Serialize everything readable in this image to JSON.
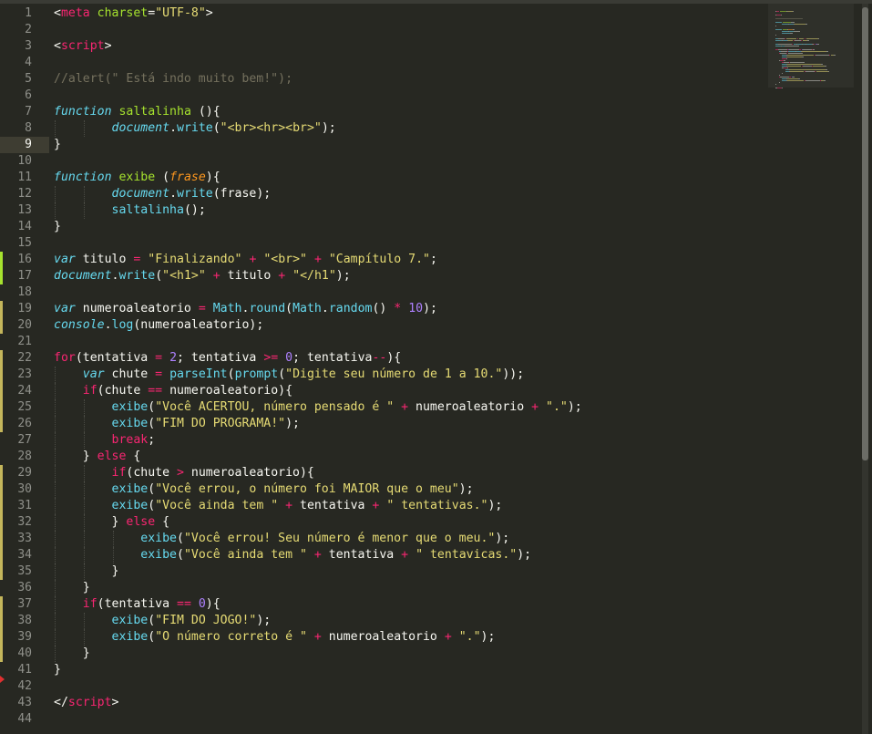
{
  "editor": {
    "theme_colors": {
      "background": "#272822",
      "text": "#F8F8F2",
      "tag": "#F92672",
      "attribute": "#A6E22E",
      "string": "#E6DB74",
      "comment": "#75715E",
      "storage": "#66D9EF",
      "entity": "#A6E22E",
      "parameter": "#FD971F",
      "keyword": "#F92672",
      "number": "#AE81FF",
      "gutter_added": "#A6E22E",
      "gutter_modified": "#C4B65B",
      "fold_marker": "#E03030"
    },
    "current_line": 9,
    "fold_marker_line": 41,
    "gutter_added_lines": [
      16,
      17
    ],
    "gutter_modified_lines": [
      19,
      20,
      22,
      23,
      24,
      25,
      26,
      29,
      30,
      31,
      32,
      33,
      34,
      35,
      37,
      38,
      39,
      40
    ],
    "lines": [
      {
        "n": "1",
        "indent": 0,
        "tokens": [
          [
            "tag-punct",
            "<"
          ],
          [
            "tag",
            "meta"
          ],
          [
            "text",
            " "
          ],
          [
            "attr",
            "charset"
          ],
          [
            "text",
            "="
          ],
          [
            "str",
            "\"UTF-8\""
          ],
          [
            "text",
            ">"
          ]
        ]
      },
      {
        "n": "2",
        "indent": 0,
        "tokens": []
      },
      {
        "n": "3",
        "indent": 0,
        "tokens": [
          [
            "text",
            "<"
          ],
          [
            "tag",
            "script"
          ],
          [
            "text",
            ">"
          ]
        ]
      },
      {
        "n": "4",
        "indent": 0,
        "tokens": []
      },
      {
        "n": "5",
        "indent": 0,
        "tokens": [
          [
            "comment",
            "//alert(\" Está indo muito bem!\");"
          ]
        ]
      },
      {
        "n": "6",
        "indent": 0,
        "tokens": []
      },
      {
        "n": "7",
        "indent": 0,
        "tokens": [
          [
            "storage",
            "function"
          ],
          [
            "text",
            " "
          ],
          [
            "entity",
            "saltalinha"
          ],
          [
            "text",
            " (){"
          ]
        ]
      },
      {
        "n": "8",
        "indent": 2,
        "tokens": [
          [
            "support-i",
            "document"
          ],
          [
            "text",
            "."
          ],
          [
            "support",
            "write"
          ],
          [
            "text",
            "("
          ],
          [
            "str",
            "\"<br><hr><br>\""
          ],
          [
            "text",
            ");"
          ]
        ]
      },
      {
        "n": "9",
        "indent": 0,
        "tokens": [
          [
            "text",
            "}"
          ]
        ]
      },
      {
        "n": "10",
        "indent": 0,
        "tokens": []
      },
      {
        "n": "11",
        "indent": 0,
        "tokens": [
          [
            "storage",
            "function"
          ],
          [
            "text",
            " "
          ],
          [
            "entity",
            "exibe"
          ],
          [
            "text",
            " ("
          ],
          [
            "param",
            "frase"
          ],
          [
            "text",
            "){"
          ]
        ]
      },
      {
        "n": "12",
        "indent": 2,
        "tokens": [
          [
            "support-i",
            "document"
          ],
          [
            "text",
            "."
          ],
          [
            "support",
            "write"
          ],
          [
            "text",
            "(frase);"
          ]
        ]
      },
      {
        "n": "13",
        "indent": 2,
        "tokens": [
          [
            "support",
            "saltalinha"
          ],
          [
            "text",
            "();"
          ]
        ]
      },
      {
        "n": "14",
        "indent": 0,
        "tokens": [
          [
            "text",
            "}"
          ]
        ]
      },
      {
        "n": "15",
        "indent": 0,
        "tokens": []
      },
      {
        "n": "16",
        "indent": 0,
        "tokens": [
          [
            "storage",
            "var"
          ],
          [
            "text",
            " titulo "
          ],
          [
            "op",
            "="
          ],
          [
            "text",
            " "
          ],
          [
            "str",
            "\"Finalizando\""
          ],
          [
            "text",
            " "
          ],
          [
            "op",
            "+"
          ],
          [
            "text",
            " "
          ],
          [
            "str",
            "\"<br>\""
          ],
          [
            "text",
            " "
          ],
          [
            "op",
            "+"
          ],
          [
            "text",
            " "
          ],
          [
            "str",
            "\"Campítulo 7.\""
          ],
          [
            "text",
            ";"
          ]
        ]
      },
      {
        "n": "17",
        "indent": 0,
        "tokens": [
          [
            "support-i",
            "document"
          ],
          [
            "text",
            "."
          ],
          [
            "support",
            "write"
          ],
          [
            "text",
            "("
          ],
          [
            "str",
            "\"<h1>\""
          ],
          [
            "text",
            " "
          ],
          [
            "op",
            "+"
          ],
          [
            "text",
            " titulo "
          ],
          [
            "op",
            "+"
          ],
          [
            "text",
            " "
          ],
          [
            "str",
            "\"</h1\""
          ],
          [
            "text",
            ");"
          ]
        ]
      },
      {
        "n": "18",
        "indent": 0,
        "tokens": []
      },
      {
        "n": "19",
        "indent": 0,
        "tokens": [
          [
            "storage",
            "var"
          ],
          [
            "text",
            " numeroaleatorio "
          ],
          [
            "op",
            "="
          ],
          [
            "text",
            " "
          ],
          [
            "support",
            "Math"
          ],
          [
            "text",
            "."
          ],
          [
            "support",
            "round"
          ],
          [
            "text",
            "("
          ],
          [
            "support",
            "Math"
          ],
          [
            "text",
            "."
          ],
          [
            "support",
            "random"
          ],
          [
            "text",
            "() "
          ],
          [
            "op",
            "*"
          ],
          [
            "text",
            " "
          ],
          [
            "num",
            "10"
          ],
          [
            "text",
            ");"
          ]
        ]
      },
      {
        "n": "20",
        "indent": 0,
        "tokens": [
          [
            "support-i",
            "console"
          ],
          [
            "text",
            "."
          ],
          [
            "support",
            "log"
          ],
          [
            "text",
            "(numeroaleatorio);"
          ]
        ]
      },
      {
        "n": "21",
        "indent": 0,
        "tokens": []
      },
      {
        "n": "22",
        "indent": 0,
        "tokens": [
          [
            "kw",
            "for"
          ],
          [
            "text",
            "(tentativa "
          ],
          [
            "op",
            "="
          ],
          [
            "text",
            " "
          ],
          [
            "num",
            "2"
          ],
          [
            "text",
            "; tentativa "
          ],
          [
            "op",
            ">="
          ],
          [
            "text",
            " "
          ],
          [
            "num",
            "0"
          ],
          [
            "text",
            "; tentativa"
          ],
          [
            "op",
            "--"
          ],
          [
            "text",
            "){"
          ]
        ]
      },
      {
        "n": "23",
        "indent": 1,
        "tokens": [
          [
            "storage",
            "var"
          ],
          [
            "text",
            " chute "
          ],
          [
            "op",
            "="
          ],
          [
            "text",
            " "
          ],
          [
            "support",
            "parseInt"
          ],
          [
            "text",
            "("
          ],
          [
            "support",
            "prompt"
          ],
          [
            "text",
            "("
          ],
          [
            "str",
            "\"Digite seu número de 1 a 10.\""
          ],
          [
            "text",
            "));"
          ]
        ]
      },
      {
        "n": "24",
        "indent": 1,
        "tokens": [
          [
            "kw",
            "if"
          ],
          [
            "text",
            "(chute "
          ],
          [
            "op",
            "=="
          ],
          [
            "text",
            " numeroaleatorio){"
          ]
        ]
      },
      {
        "n": "25",
        "indent": 2,
        "tokens": [
          [
            "support",
            "exibe"
          ],
          [
            "text",
            "("
          ],
          [
            "str",
            "\"Você ACERTOU, número pensado é \""
          ],
          [
            "text",
            " "
          ],
          [
            "op",
            "+"
          ],
          [
            "text",
            " numeroaleatorio "
          ],
          [
            "op",
            "+"
          ],
          [
            "text",
            " "
          ],
          [
            "str",
            "\".\""
          ],
          [
            "text",
            ");"
          ]
        ]
      },
      {
        "n": "26",
        "indent": 2,
        "tokens": [
          [
            "support",
            "exibe"
          ],
          [
            "text",
            "("
          ],
          [
            "str",
            "\"FIM DO PROGRAMA!\""
          ],
          [
            "text",
            ");"
          ]
        ]
      },
      {
        "n": "27",
        "indent": 2,
        "tokens": [
          [
            "kw",
            "break"
          ],
          [
            "text",
            ";"
          ]
        ]
      },
      {
        "n": "28",
        "indent": 1,
        "tokens": [
          [
            "text",
            "} "
          ],
          [
            "kw",
            "else"
          ],
          [
            "text",
            " {"
          ]
        ]
      },
      {
        "n": "29",
        "indent": 2,
        "tokens": [
          [
            "kw",
            "if"
          ],
          [
            "text",
            "(chute "
          ],
          [
            "op",
            ">"
          ],
          [
            "text",
            " numeroaleatorio){"
          ]
        ]
      },
      {
        "n": "30",
        "indent": 2,
        "tokens": [
          [
            "support",
            "exibe"
          ],
          [
            "text",
            "("
          ],
          [
            "str",
            "\"Você errou, o número foi MAIOR que o meu\""
          ],
          [
            "text",
            ");"
          ]
        ]
      },
      {
        "n": "31",
        "indent": 2,
        "tokens": [
          [
            "support",
            "exibe"
          ],
          [
            "text",
            "("
          ],
          [
            "str",
            "\"Você ainda tem \""
          ],
          [
            "text",
            " "
          ],
          [
            "op",
            "+"
          ],
          [
            "text",
            " tentativa "
          ],
          [
            "op",
            "+"
          ],
          [
            "text",
            " "
          ],
          [
            "str",
            "\" tentativas.\""
          ],
          [
            "text",
            ");"
          ]
        ]
      },
      {
        "n": "32",
        "indent": 2,
        "tokens": [
          [
            "text",
            "} "
          ],
          [
            "kw",
            "else"
          ],
          [
            "text",
            " {"
          ]
        ]
      },
      {
        "n": "33",
        "indent": 3,
        "tokens": [
          [
            "support",
            "exibe"
          ],
          [
            "text",
            "("
          ],
          [
            "str",
            "\"Você errou! Seu número é menor que o meu.\""
          ],
          [
            "text",
            ");"
          ]
        ]
      },
      {
        "n": "34",
        "indent": 3,
        "tokens": [
          [
            "support",
            "exibe"
          ],
          [
            "text",
            "("
          ],
          [
            "str",
            "\"Você ainda tem \""
          ],
          [
            "text",
            " "
          ],
          [
            "op",
            "+"
          ],
          [
            "text",
            " tentativa "
          ],
          [
            "op",
            "+"
          ],
          [
            "text",
            " "
          ],
          [
            "str",
            "\" tentavicas.\""
          ],
          [
            "text",
            ");"
          ]
        ]
      },
      {
        "n": "35",
        "indent": 2,
        "tokens": [
          [
            "text",
            "}"
          ]
        ]
      },
      {
        "n": "36",
        "indent": 1,
        "tokens": [
          [
            "text",
            "}"
          ]
        ]
      },
      {
        "n": "37",
        "indent": 1,
        "tokens": [
          [
            "kw",
            "if"
          ],
          [
            "text",
            "(tentativa "
          ],
          [
            "op",
            "=="
          ],
          [
            "text",
            " "
          ],
          [
            "num",
            "0"
          ],
          [
            "text",
            "){"
          ]
        ]
      },
      {
        "n": "38",
        "indent": 2,
        "tokens": [
          [
            "support",
            "exibe"
          ],
          [
            "text",
            "("
          ],
          [
            "str",
            "\"FIM DO JOGO!\""
          ],
          [
            "text",
            ");"
          ]
        ]
      },
      {
        "n": "39",
        "indent": 2,
        "tokens": [
          [
            "support",
            "exibe"
          ],
          [
            "text",
            "("
          ],
          [
            "str",
            "\"O número correto é \""
          ],
          [
            "text",
            " "
          ],
          [
            "op",
            "+"
          ],
          [
            "text",
            " numeroaleatorio "
          ],
          [
            "op",
            "+"
          ],
          [
            "text",
            " "
          ],
          [
            "str",
            "\".\""
          ],
          [
            "text",
            ");"
          ]
        ]
      },
      {
        "n": "40",
        "indent": 1,
        "tokens": [
          [
            "text",
            "}"
          ]
        ]
      },
      {
        "n": "41",
        "indent": 0,
        "tokens": [
          [
            "text",
            "}"
          ]
        ]
      },
      {
        "n": "42",
        "indent": 0,
        "tokens": []
      },
      {
        "n": "43",
        "indent": 0,
        "tokens": [
          [
            "text",
            "</"
          ],
          [
            "tag",
            "script"
          ],
          [
            "text",
            ">"
          ]
        ]
      },
      {
        "n": "44",
        "indent": 0,
        "tokens": []
      }
    ]
  }
}
